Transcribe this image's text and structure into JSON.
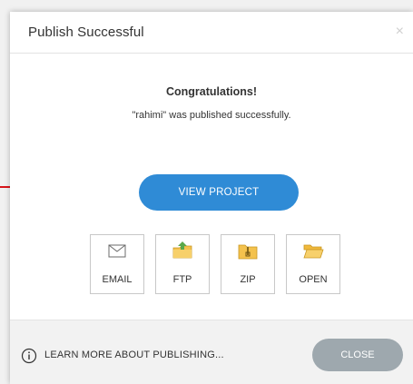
{
  "dialog": {
    "title": "Publish Successful",
    "close_glyph": "×",
    "heading": "Congratulations!",
    "message": "\"rahimi\" was published successfully.",
    "primary_button": "VIEW PROJECT",
    "tiles": [
      {
        "label": "EMAIL",
        "icon": "envelope-icon"
      },
      {
        "label": "FTP",
        "icon": "ftp-folder-icon"
      },
      {
        "label": "ZIP",
        "icon": "zip-folder-icon"
      },
      {
        "label": "OPEN",
        "icon": "open-folder-icon"
      }
    ],
    "footer": {
      "learn_more": "LEARN MORE ABOUT PUBLISHING...",
      "close_button": "CLOSE"
    }
  },
  "colors": {
    "primary": "#2f8bd6",
    "close_button": "#9ea8ae",
    "arrow": "#d8141a"
  }
}
